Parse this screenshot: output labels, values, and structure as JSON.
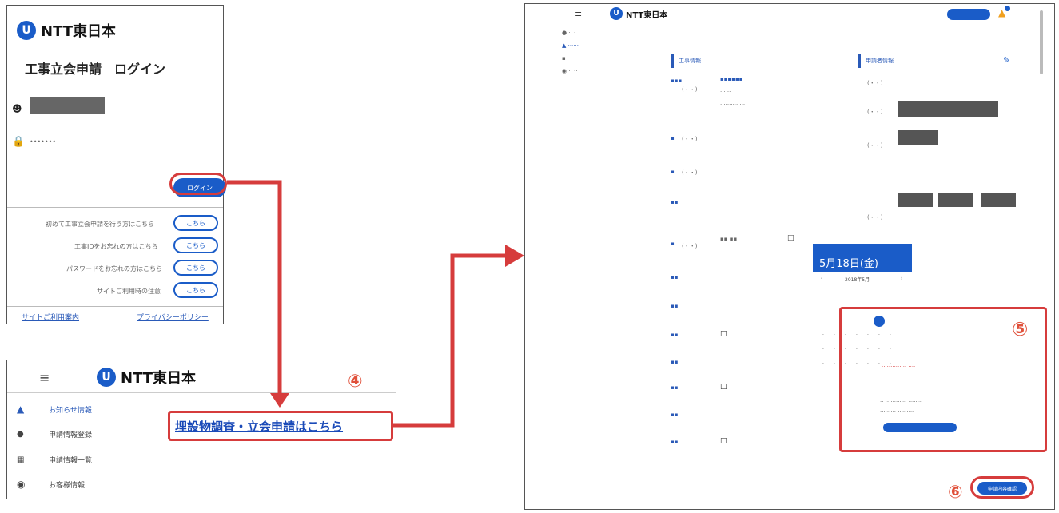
{
  "login": {
    "brand": "NTT東日本",
    "title": "工事立会申請　ログイン",
    "password_mask": "•••••••",
    "login_button": "ログイン",
    "links": [
      "初めて工事立会申請を行う方はこちら",
      "工事IDをお忘れの方はこちら",
      "パスワードをお忘れの方はこちら",
      "サイトご利用時の注意"
    ],
    "link_button": "こちら",
    "footer_left": "サイトご利用案内",
    "footer_right": "プライバシーポリシー"
  },
  "menu": {
    "brand": "NTT東日本",
    "items": [
      "お知らせ情報",
      "申請情報登録",
      "申請情報一覧",
      "お客様情報"
    ],
    "link_text": "埋設物調査・立会申請はこちら",
    "step": "④"
  },
  "form": {
    "brand": "NTT東日本",
    "section_left": "工事情報",
    "section_right": "申請者情報",
    "date_picker_text": "5月18日(金)",
    "month_label": "2018年5月",
    "step5": "⑤",
    "step6": "⑥",
    "submit_button": "申請内容確認"
  },
  "colors": {
    "brand_blue": "#1a5cc8",
    "annotation_red": "#d63c3c"
  }
}
